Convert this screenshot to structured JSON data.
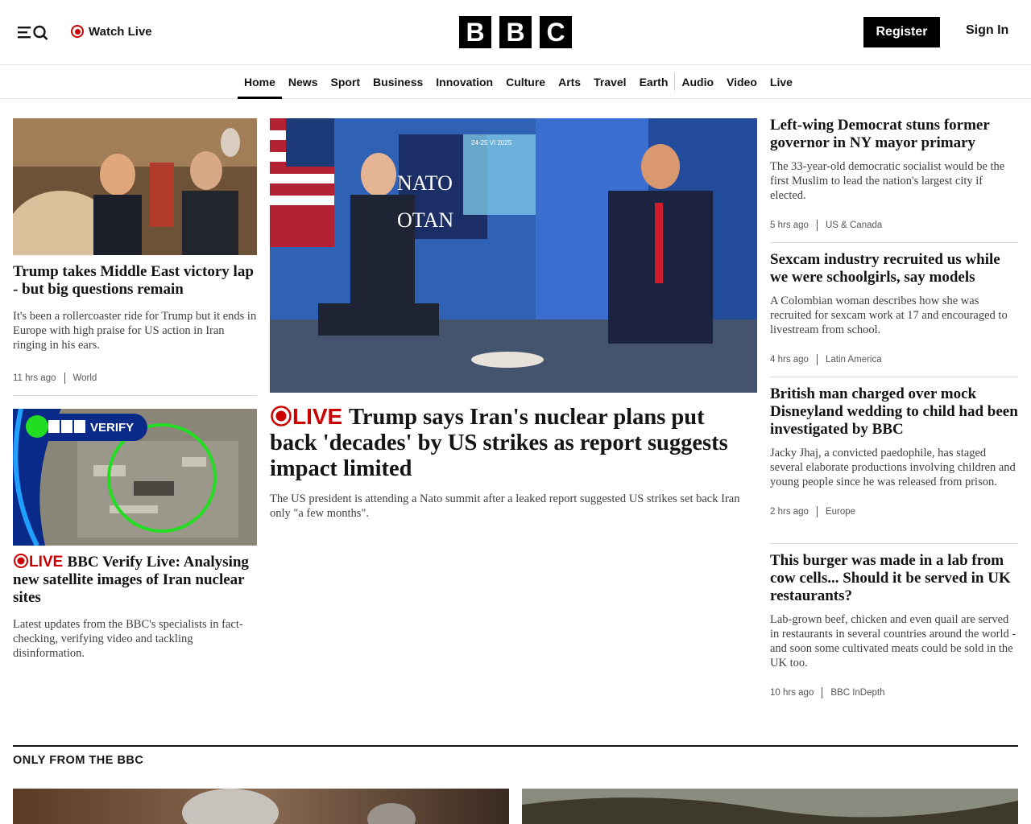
{
  "header": {
    "watch_live": "Watch Live",
    "logo_letters": [
      "B",
      "B",
      "C"
    ],
    "register": "Register",
    "sign_in": "Sign In"
  },
  "nav": {
    "items": [
      "Home",
      "News",
      "Sport",
      "Business",
      "Innovation",
      "Culture",
      "Arts",
      "Travel",
      "Earth",
      "Audio",
      "Video",
      "Live"
    ],
    "active": "Home"
  },
  "left": {
    "story1": {
      "headline": "Trump takes Middle East victory lap - but big questions remain",
      "summary": "It's been a rollercoaster ride for Trump but it ends in Europe with high praise for US action in Iran ringing in his ears.",
      "time": "11 hrs ago",
      "section": "World"
    },
    "story2": {
      "image_badge": "VERIFY",
      "live": "LIVE",
      "headline": "BBC Verify Live: Analysing new satellite images of Iran nuclear sites",
      "summary": "Latest updates from the BBC's specialists in fact-checking, verifying video and tackling disinformation."
    }
  },
  "center": {
    "image_text": {
      "nato": "NATO",
      "otan": "OTAN",
      "summit": "24-25 VI 2025"
    },
    "live": "LIVE",
    "headline": "Trump says Iran's nuclear plans put back 'decades' by US strikes as report suggests impact limited",
    "summary": "The US president is attending a Nato summit after a leaked report suggested US strikes set back Iran only \"a few months\"."
  },
  "right": [
    {
      "headline": "Left-wing Democrat stuns former governor in NY mayor primary",
      "summary": "The 33-year-old democratic socialist would be the first Muslim to lead the nation's largest city if elected.",
      "time": "5 hrs ago",
      "section": "US & Canada"
    },
    {
      "headline": "Sexcam industry recruited us while we were schoolgirls, say models",
      "summary": "A Colombian woman describes how she was recruited for sexcam work at 17 and encouraged to livestream from school.",
      "time": "4 hrs ago",
      "section": "Latin America"
    },
    {
      "headline": "British man charged over mock Disneyland wedding to child had been investigated by BBC",
      "summary": "Jacky Jhaj, a convicted paedophile, has staged several elaborate productions involving children and young people since he was released from prison.",
      "time": "2 hrs ago",
      "section": "Europe"
    },
    {
      "headline": "This burger was made in a lab from cow cells... Should it be served in UK restaurants?",
      "summary": "Lab-grown beef, chicken and even quail are served in restaurants in several countries around the world - and soon some cultivated meats could be sold in the UK too.",
      "time": "10 hrs ago",
      "section": "BBC InDepth"
    }
  ],
  "only_from_bbc": {
    "title": "ONLY FROM THE BBC"
  }
}
